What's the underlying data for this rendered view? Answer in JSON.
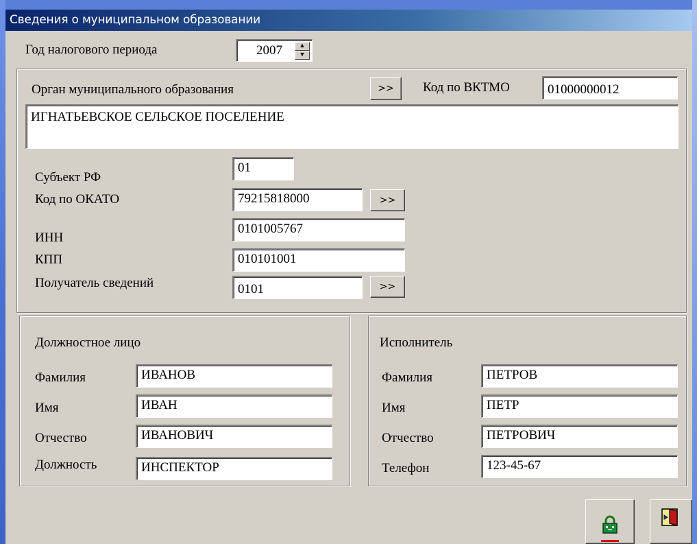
{
  "window": {
    "title": "Сведения о муниципальном образовании"
  },
  "tax_period": {
    "label": "Год налогового периода",
    "value": "2007"
  },
  "org": {
    "label": "Орган муниципального образования",
    "browse_label": ">>",
    "oktmo_label": "Код по ВКТМО",
    "oktmo_value": "01000000012",
    "name": "ИГНАТЬЕВСКОЕ СЕЛЬСКОЕ ПОСЕЛЕНИЕ"
  },
  "details": {
    "subject_label": "Субъект РФ",
    "subject_value": "01",
    "okato_label": "Код по ОКАТО",
    "okato_value": "79215818000",
    "okato_browse": ">>",
    "inn_label": "ИНН",
    "inn_value": "0101005767",
    "kpp_label": "КПП",
    "kpp_value": "010101001",
    "recipient_label": "Получатель сведений",
    "recipient_value": "0101",
    "recipient_browse": ">>"
  },
  "official": {
    "title": "Должностное лицо",
    "surname_label": "Фамилия",
    "surname": "ИВАНОВ",
    "name_label": "Имя",
    "name": "ИВАН",
    "patronymic_label": "Отчество",
    "patronymic": "ИВАНОВИЧ",
    "position_label": "Должность",
    "position": "ИНСПЕКТОР"
  },
  "executor": {
    "title": "Исполнитель",
    "surname_label": "Фамилия",
    "surname": "ПЕТРОВ",
    "name_label": "Имя",
    "name": "ПЕТР",
    "patronymic_label": "Отчество",
    "patronymic": "ПЕТРОВИЧ",
    "phone_label": "Телефон",
    "phone": "123-45-67"
  },
  "colors": {
    "window_bg": "#d4d0c8",
    "titlebar": "#0a246a",
    "desktop": "#5a7fd9"
  },
  "icons": {
    "save": "save-lock-icon",
    "exit": "exit-door-icon"
  }
}
